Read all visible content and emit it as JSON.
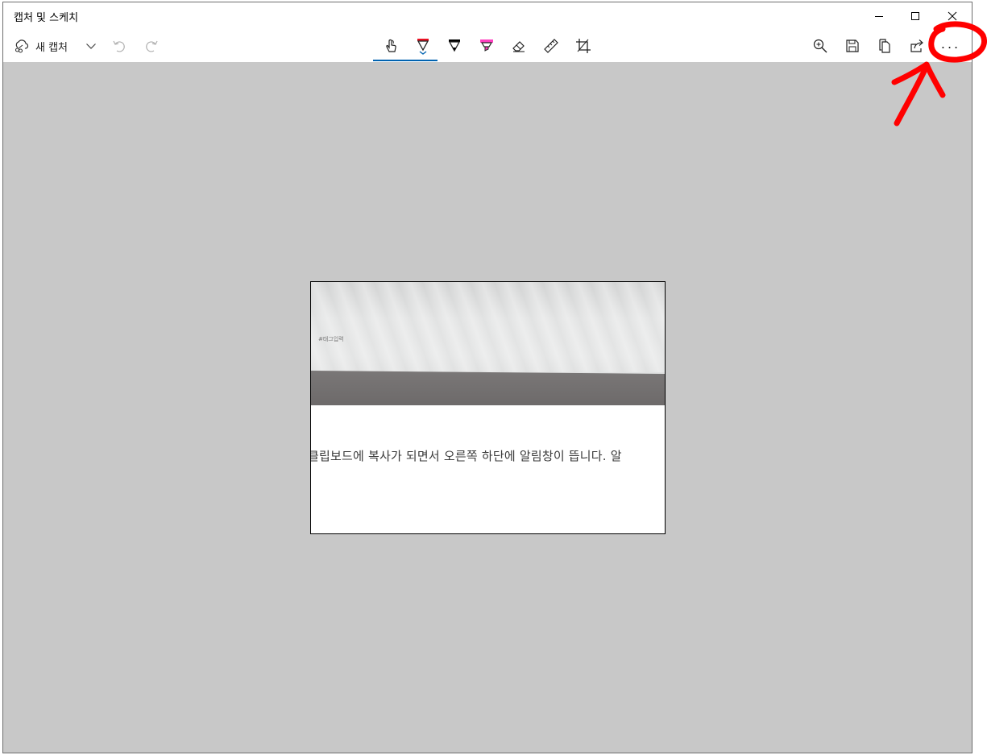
{
  "window": {
    "title": "캡처 및 스케치"
  },
  "toolbar": {
    "new_capture_label": "새 캡처",
    "tools": [
      "touch-writing",
      "ballpoint-pen",
      "pencil",
      "highlighter",
      "eraser",
      "ruler",
      "crop"
    ],
    "right_tools": [
      "zoom",
      "save",
      "copy",
      "share",
      "more"
    ],
    "more_label": "..."
  },
  "capture": {
    "photo_tag": "#태그입력",
    "text": "클립보드에 복사가 되면서 오른쪽 하단에 알림창이 뜹니다. 알"
  },
  "colors": {
    "accent": "#0063b1",
    "canvas_bg": "#c8c8c8",
    "pen_red": "#e81123",
    "highlighter_pink": "#ff3fc0",
    "annotation_red": "#ff0000"
  }
}
